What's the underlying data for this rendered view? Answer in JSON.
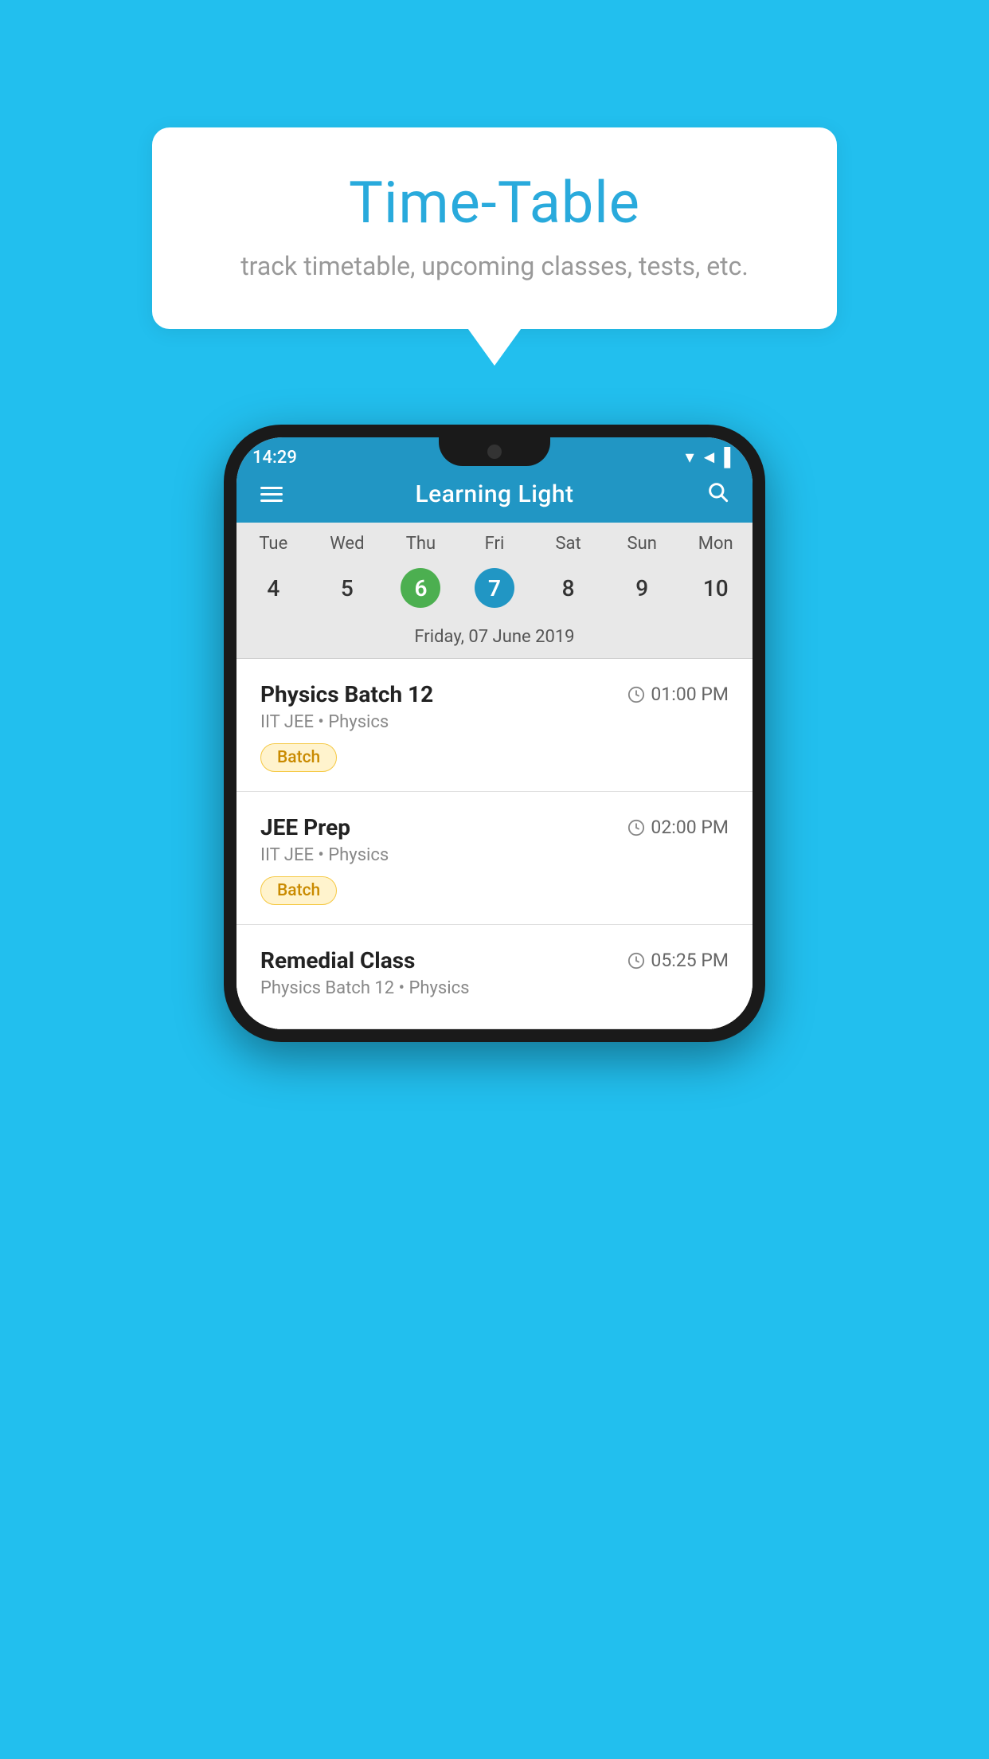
{
  "background_color": "#22BFEE",
  "tooltip_card": {
    "title": "Time-Table",
    "subtitle": "track timetable, upcoming classes, tests, etc."
  },
  "phone": {
    "status_bar": {
      "time": "14:29",
      "signal_icon": "▼◄▌"
    },
    "app_bar": {
      "title": "Learning Light",
      "menu_icon": "hamburger",
      "search_icon": "search"
    },
    "calendar": {
      "days": [
        {
          "label": "Tue",
          "number": "4"
        },
        {
          "label": "Wed",
          "number": "5"
        },
        {
          "label": "Thu",
          "number": "6",
          "state": "today"
        },
        {
          "label": "Fri",
          "number": "7",
          "state": "selected"
        },
        {
          "label": "Sat",
          "number": "8"
        },
        {
          "label": "Sun",
          "number": "9"
        },
        {
          "label": "Mon",
          "number": "10"
        }
      ],
      "selected_date_label": "Friday, 07 June 2019"
    },
    "classes": [
      {
        "name": "Physics Batch 12",
        "time": "01:00 PM",
        "meta": "IIT JEE • Physics",
        "tag": "Batch"
      },
      {
        "name": "JEE Prep",
        "time": "02:00 PM",
        "meta": "IIT JEE • Physics",
        "tag": "Batch"
      },
      {
        "name": "Remedial Class",
        "time": "05:25 PM",
        "meta": "Physics Batch 12 • Physics",
        "tag": ""
      }
    ]
  }
}
